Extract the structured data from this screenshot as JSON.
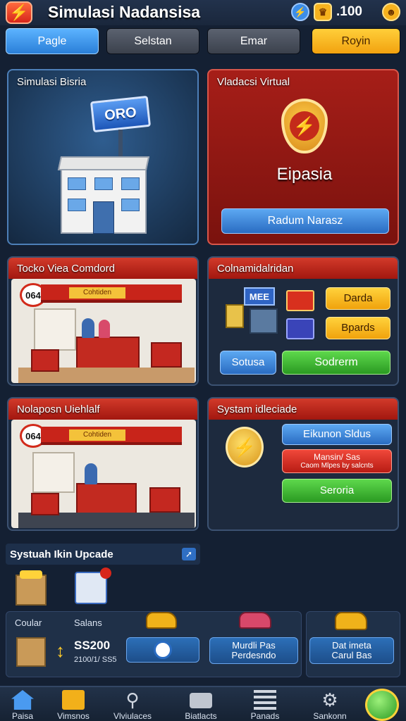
{
  "header": {
    "title": "Simulasi Nadansisa",
    "coins": ".100",
    "icons": [
      "lightning-icon",
      "crown-icon",
      "face-icon"
    ]
  },
  "tabs": [
    {
      "label": "Pagle",
      "style": "blue"
    },
    {
      "label": "Selstan",
      "style": "grey"
    },
    {
      "label": "Emar",
      "style": "grey"
    },
    {
      "label": "Royin",
      "style": "gold"
    }
  ],
  "panels": {
    "simulasi": {
      "title": "Simulasi Bisria",
      "sign": "ORO"
    },
    "virtual": {
      "title": "Vladacsi Virtual",
      "badge_label": "Eipasia",
      "button": "Radum Narasz"
    },
    "toko": {
      "title": "Tocko Viea Comdord",
      "scene_badge": "064",
      "store_sign": "Cohtiden"
    },
    "colnam": {
      "title": "Colnamidalridan",
      "sign": "MEE",
      "btn1": "Darda",
      "btn2": "Bpards",
      "btn3": "Sotusa",
      "btn4": "Sodrerm"
    },
    "nolap": {
      "title": "Nolaposn Uiehlalf",
      "scene_badge": "064",
      "store_sign": "Cohtiden"
    },
    "system": {
      "title": "Systam idleciade",
      "btn1": "Eikunon Sldus",
      "btn2_line1": "Mansin/ Sas",
      "btn2_line2": "Caom Mlpes by salcnts",
      "btn3": "Seroria"
    },
    "upgrade": {
      "title": "Systuah Ikin Upcade",
      "label1": "Coular",
      "label2": "Salans",
      "price": "SS200",
      "price_sub": "2100/1/ SS5",
      "btn_mid_line1": "Murdli Pas",
      "btn_mid_line2": "Perdesndo",
      "btn_right_line1": "Dat imeta",
      "btn_right_line2": "Carul Bas"
    }
  },
  "nav": [
    {
      "label": "Paisa",
      "icon": "home-icon"
    },
    {
      "label": "Vimsnos",
      "icon": "folder-icon"
    },
    {
      "label": "Vlviulaces",
      "icon": "search-icon"
    },
    {
      "label": "Biatlacts",
      "icon": "camera-icon"
    },
    {
      "label": "Panads",
      "icon": "list-icon"
    },
    {
      "label": "Sankonn",
      "icon": "gear-icon"
    }
  ],
  "colors": {
    "accent_blue": "#2a7fd8",
    "accent_gold": "#f2a20f",
    "accent_red": "#b81c14",
    "accent_green": "#2a9a22"
  }
}
